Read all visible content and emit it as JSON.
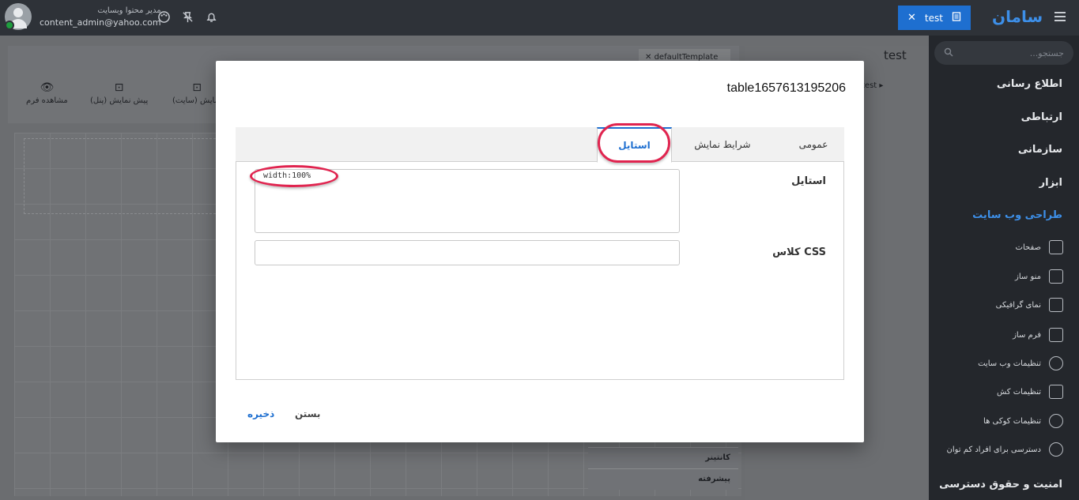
{
  "header": {
    "user_role": "مدیر محتوا وبسایت",
    "user_email": "content_admin@yahoo.com",
    "open_tab_label": "test",
    "brand": "سامان"
  },
  "sidebar": {
    "search_placeholder": "جستجو...",
    "sections": [
      "اطلاع رسانی",
      "ارتباطی",
      "سازمانی",
      "ابزار",
      "طراحی وب سایت",
      "امنیت و حقوق دسترسی"
    ],
    "sub_items": [
      "صفحات",
      "منو ساز",
      "نمای گرافیکی",
      "فرم ساز",
      "تنظیمات وب سایت",
      "تنظیمات کش",
      "تنظیمات کوکی ها",
      "دسترسی برای افراد کم توان"
    ]
  },
  "workspace": {
    "title": "test",
    "doc_tab": "defaultTemplate",
    "tree_root": "test",
    "toolbar": [
      "مشاهده فرم",
      "پیش نمایش (پنل)",
      "نمایش (سایت)"
    ],
    "list_items": [
      "کانتینر",
      "پیشرفته"
    ]
  },
  "modal": {
    "title": "table1657613195206",
    "tabs": [
      "عمومی",
      "شرایط نمایش",
      "استایل"
    ],
    "active_tab": "استایل",
    "style_label": "استایل",
    "style_value": "width:100%",
    "css_class_label": "کلاس CSS",
    "css_class_value": "",
    "save_label": "ذخیره",
    "close_label": "بستن"
  },
  "colors": {
    "accent": "#1e6fd0",
    "highlight": "#e0244f",
    "sidebar_bg": "#24272c"
  }
}
